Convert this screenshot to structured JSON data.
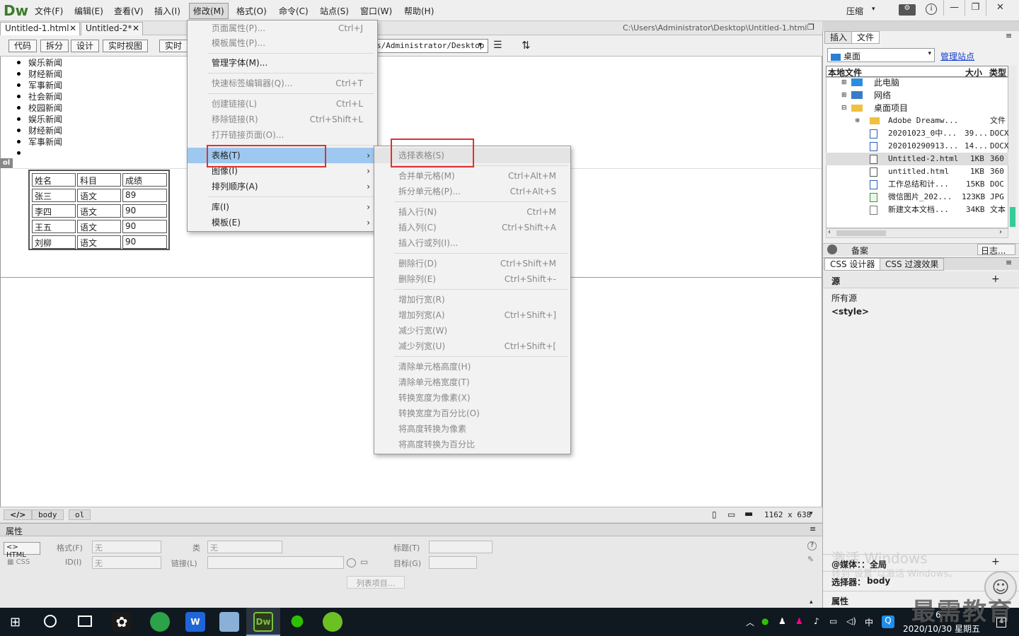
{
  "app": {
    "logo": "Dw",
    "compress": "压缩"
  },
  "menubar": [
    "文件(F)",
    "编辑(E)",
    "查看(V)",
    "插入(I)",
    "修改(M)",
    "格式(O)",
    "命令(C)",
    "站点(S)",
    "窗口(W)",
    "帮助(H)"
  ],
  "tabs": [
    {
      "label": "Untitled-1.html"
    },
    {
      "label": "Untitled-2*"
    }
  ],
  "doc_path": "C:\\Users\\Administrator\\Desktop\\Untitled-1.html",
  "viewbar": {
    "code": "代码",
    "split": "拆分",
    "design": "设计",
    "live": "实时视图",
    "live2": "实时代",
    "address": "s/Administrator/Desktop"
  },
  "list_items": [
    "娱乐新闻",
    "财经新闻",
    "军事新闻",
    "社会新闻",
    "校园新闻",
    "娱乐新闻",
    "财经新闻",
    "军事新闻"
  ],
  "ol_tag": "ol",
  "table": {
    "header": [
      "姓名",
      "科目",
      "成绩"
    ],
    "rows": [
      [
        "张三",
        "语文",
        "89"
      ],
      [
        "李四",
        "语文",
        "90"
      ],
      [
        "王五",
        "语文",
        "90"
      ],
      [
        "刘柳",
        "语文",
        "90"
      ]
    ]
  },
  "statusbar": {
    "tag_body": "body",
    "tag_ol": "ol",
    "size": "1162 x 638"
  },
  "props": {
    "title": "属性",
    "html": "HTML",
    "css": "CSS",
    "format": "格式(F)",
    "format_val": "无",
    "class": "类",
    "class_val": "无",
    "id": "ID(I)",
    "id_val": "无",
    "link": "链接(L)",
    "title_label": "标题(T)",
    "target": "目标(G)",
    "list_item": "列表项目..."
  },
  "menu1": [
    {
      "label": "页面属性(P)...",
      "sc": "Ctrl+J",
      "dis": true
    },
    {
      "label": "模板属性(P)...",
      "sc": "",
      "dis": true
    },
    {
      "label": "管理字体(M)...",
      "sc": "",
      "dis": false
    },
    {
      "label": "快速标签编辑器(Q)...",
      "sc": "Ctrl+T",
      "dis": true
    },
    {
      "label": "创建链接(L)",
      "sc": "Ctrl+L",
      "dis": true
    },
    {
      "label": "移除链接(R)",
      "sc": "Ctrl+Shift+L",
      "dis": true
    },
    {
      "label": "打开链接页面(O)...",
      "sc": "",
      "dis": true
    },
    {
      "label": "表格(T)",
      "sc": "",
      "dis": false
    },
    {
      "label": "图像(I)",
      "sc": "",
      "dis": false
    },
    {
      "label": "排列顺序(A)",
      "sc": "",
      "dis": false
    },
    {
      "label": "库(I)",
      "sc": "",
      "dis": false
    },
    {
      "label": "模板(E)",
      "sc": "",
      "dis": false
    }
  ],
  "menu2": [
    {
      "label": "选择表格(S)",
      "sc": ""
    },
    {
      "label": "合并单元格(M)",
      "sc": "Ctrl+Alt+M"
    },
    {
      "label": "拆分单元格(P)...",
      "sc": "Ctrl+Alt+S"
    },
    {
      "label": "插入行(N)",
      "sc": "Ctrl+M"
    },
    {
      "label": "插入列(C)",
      "sc": "Ctrl+Shift+A"
    },
    {
      "label": "插入行或列(I)...",
      "sc": ""
    },
    {
      "label": "删除行(D)",
      "sc": "Ctrl+Shift+M"
    },
    {
      "label": "删除列(E)",
      "sc": "Ctrl+Shift+-"
    },
    {
      "label": "增加行宽(R)",
      "sc": ""
    },
    {
      "label": "增加列宽(A)",
      "sc": "Ctrl+Shift+]"
    },
    {
      "label": "减少行宽(W)",
      "sc": ""
    },
    {
      "label": "减少列宽(U)",
      "sc": "Ctrl+Shift+["
    },
    {
      "label": "清除单元格高度(H)",
      "sc": ""
    },
    {
      "label": "清除单元格宽度(T)",
      "sc": ""
    },
    {
      "label": "转换宽度为像素(X)",
      "sc": ""
    },
    {
      "label": "转换宽度为百分比(O)",
      "sc": ""
    },
    {
      "label": "将高度转换为像素",
      "sc": ""
    },
    {
      "label": "将高度转换为百分比",
      "sc": ""
    }
  ],
  "right": {
    "tab_insert": "插入",
    "tab_files": "文件",
    "location": "桌面",
    "manage": "管理站点",
    "col_local": "本地文件",
    "col_size": "大小",
    "col_type": "类型",
    "tree": [
      {
        "name": "此电脑",
        "size": "",
        "type": ""
      },
      {
        "name": "网络",
        "size": "",
        "type": ""
      },
      {
        "name": "桌面项目",
        "size": "",
        "type": ""
      },
      {
        "name": "Adobe Dreamw...",
        "size": "",
        "type": "文件"
      },
      {
        "name": "20201023_0中...",
        "size": "39...",
        "type": "DOCX"
      },
      {
        "name": "20201029091З...",
        "size": "14...",
        "type": "DOCX"
      },
      {
        "name": "Untitled-2.html",
        "size": "1KB",
        "type": "360"
      },
      {
        "name": "untitled.html",
        "size": "1KB",
        "type": "360"
      },
      {
        "name": "工作总结和计...",
        "size": "15KB",
        "type": "DOC"
      },
      {
        "name": "微信图片_202...",
        "size": "123KB",
        "type": "JPG"
      },
      {
        "name": "新建文本文档...",
        "size": "34KB",
        "type": "文本"
      }
    ],
    "backup": "备案",
    "log": "日志...",
    "css_tab1": "CSS 设计器",
    "css_tab2": "CSS 过渡效果",
    "source": "源",
    "all_sources": "所有源",
    "style": "<style>",
    "watermark1": "激活 Windows",
    "watermark2": "转到\"设置\"以激活 Windows。",
    "media": "@媒体：：",
    "media_val": "全局",
    "selector": "选择器：",
    "selector_val": "body",
    "attr": "属性"
  },
  "taskbar": {
    "time": "6",
    "date": "2020/10/30 星期五",
    "ime": "中",
    "brand": "最需教育"
  }
}
